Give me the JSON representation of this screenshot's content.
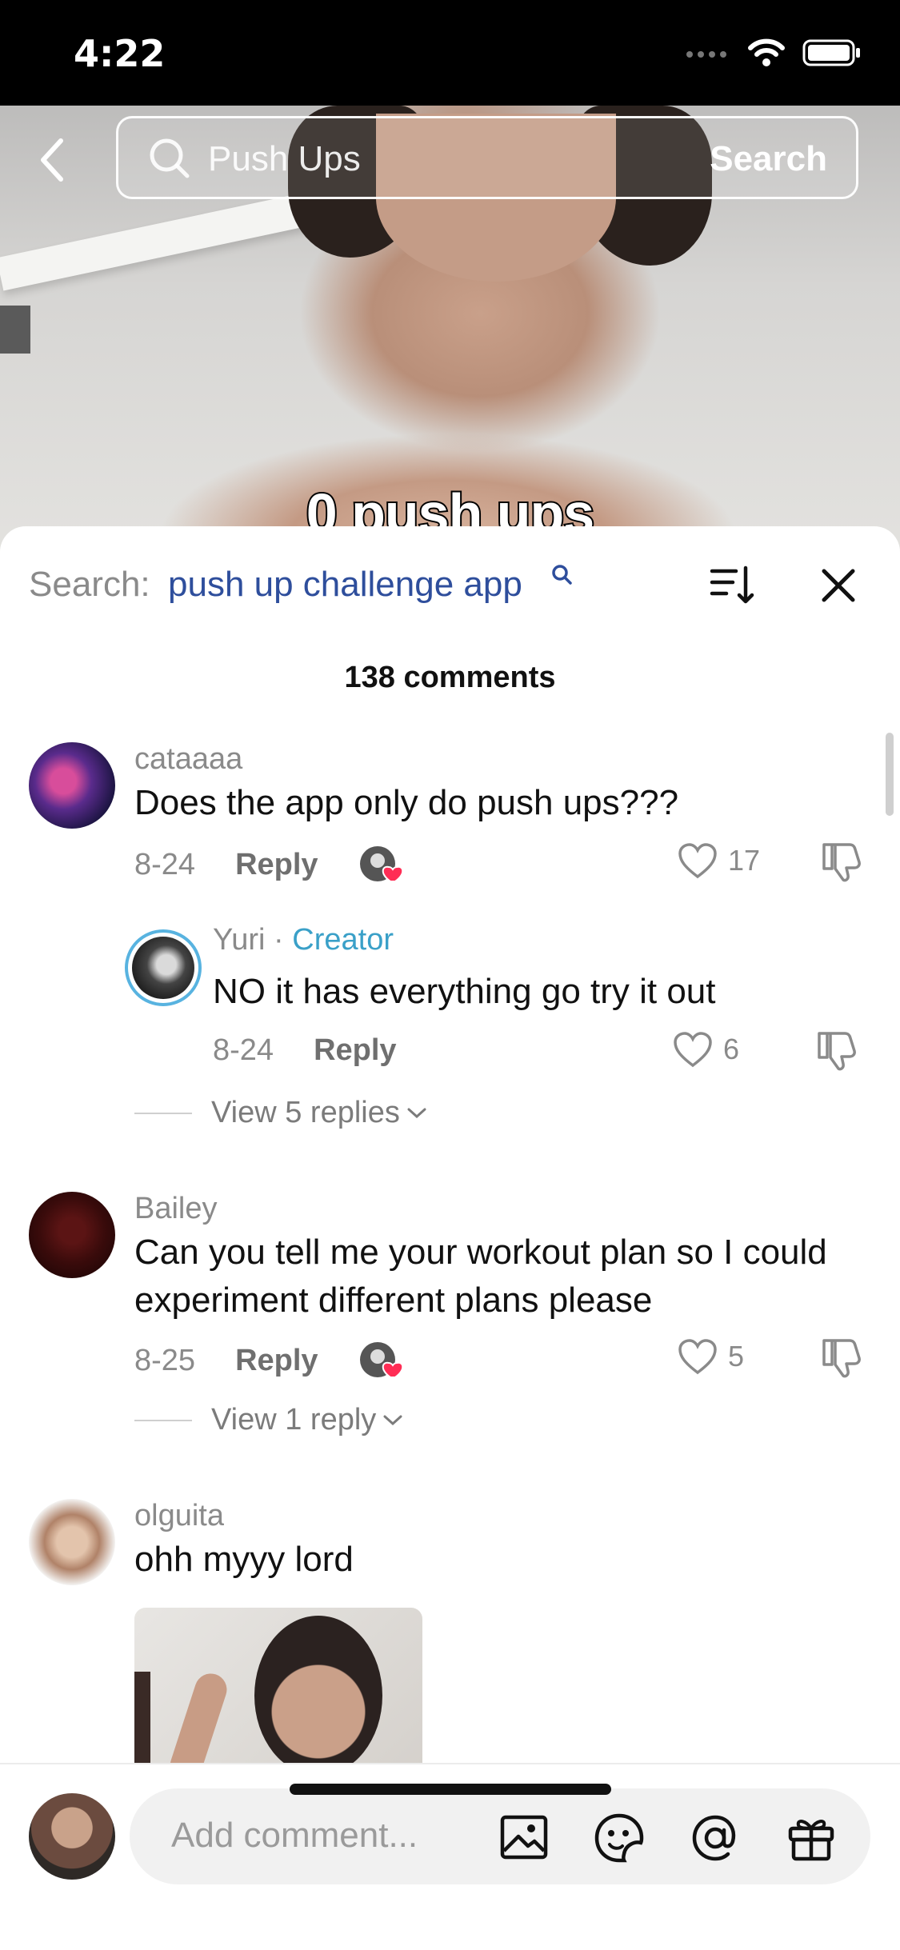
{
  "status_bar": {
    "time": "4:22"
  },
  "video": {
    "caption": "0 push ups"
  },
  "top_search": {
    "query": "Push Ups",
    "submit_label": "Search"
  },
  "sheet": {
    "search_label": "Search:",
    "search_term": "push up challenge app",
    "comment_count": "138 comments"
  },
  "comments": [
    {
      "name": "cataaaa",
      "text": "Does the app only do push ups???",
      "date": "8-24",
      "reply_label": "Reply",
      "likes": "17",
      "replies": [
        {
          "name": "Yuri",
          "separator": " · ",
          "badge": "Creator",
          "text": "NO it has everything go try it out",
          "date": "8-24",
          "reply_label": "Reply",
          "likes": "6"
        }
      ],
      "view_replies": "View 5 replies"
    },
    {
      "name": "Bailey",
      "text": "Can you tell me your workout plan so I could experiment different plans please",
      "date": "8-25",
      "reply_label": "Reply",
      "likes": "5",
      "view_replies": "View 1 reply"
    },
    {
      "name": "olguita",
      "text": "ohh myyy lord"
    }
  ],
  "input": {
    "placeholder": "Add comment..."
  },
  "icons": [
    "back-icon",
    "search-icon",
    "sort-icon",
    "close-icon",
    "heart-icon",
    "dislike-icon",
    "chevron-down-icon",
    "image-icon",
    "emoji-icon",
    "mention-icon",
    "gift-icon"
  ]
}
